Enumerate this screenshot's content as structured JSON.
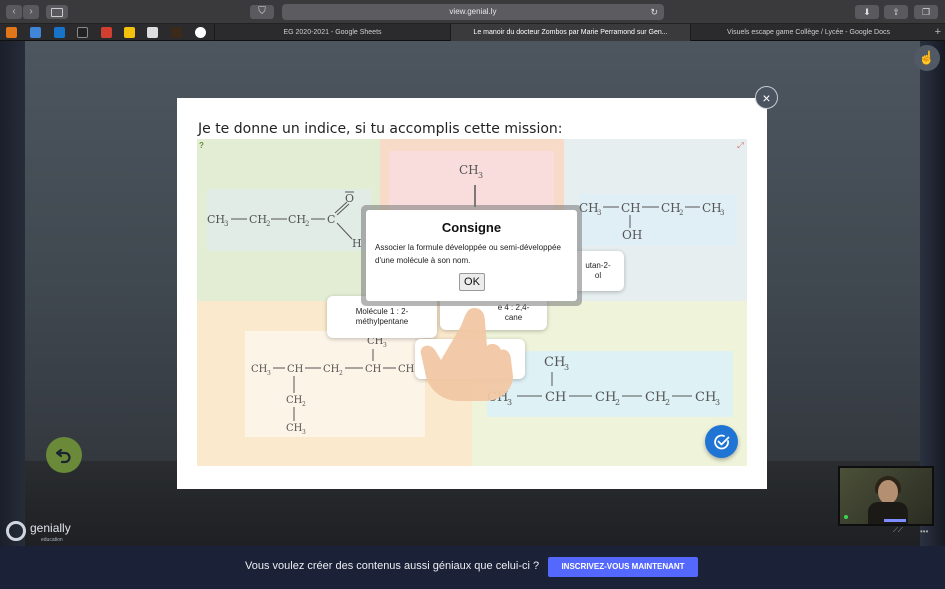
{
  "browser": {
    "address": "view.genial.ly",
    "tabs": [
      {
        "label": "EG 2020-2021 - Google Sheets"
      },
      {
        "label": "Le manoir du docteur Zombos par Marie Perramond sur Gen..."
      },
      {
        "label": "Visuels escape game Collège / Lycée - Google Docs"
      }
    ]
  },
  "modal": {
    "title": "Je te donne un indice, si tu accomplis cette mission:"
  },
  "game": {
    "molecule_labels": {
      "card_1": "Molécule 1 : 2-méthylpentane",
      "card_2": "utan-2-",
      "card_3": "ol",
      "card_4": "e 4 : 2,4-",
      "card_5": "cane"
    }
  },
  "dialog": {
    "title": "Consigne",
    "body": "Associer la formule développée ou semi-développée d'une molécule à son nom.",
    "ok_label": "OK"
  },
  "branding": {
    "logo": "genially",
    "logo_sub": "education"
  },
  "banner": {
    "text": "Vous voulez créer des contenus aussi géniaux que celui-ci ?",
    "cta": "INSCRIVEZ-VOUS MAINTENANT"
  },
  "colors": {
    "banner_bg": "#1b2136",
    "cta": "#5568fe",
    "check_button": "#1f74d4",
    "undo_button": "#6a8a39"
  }
}
